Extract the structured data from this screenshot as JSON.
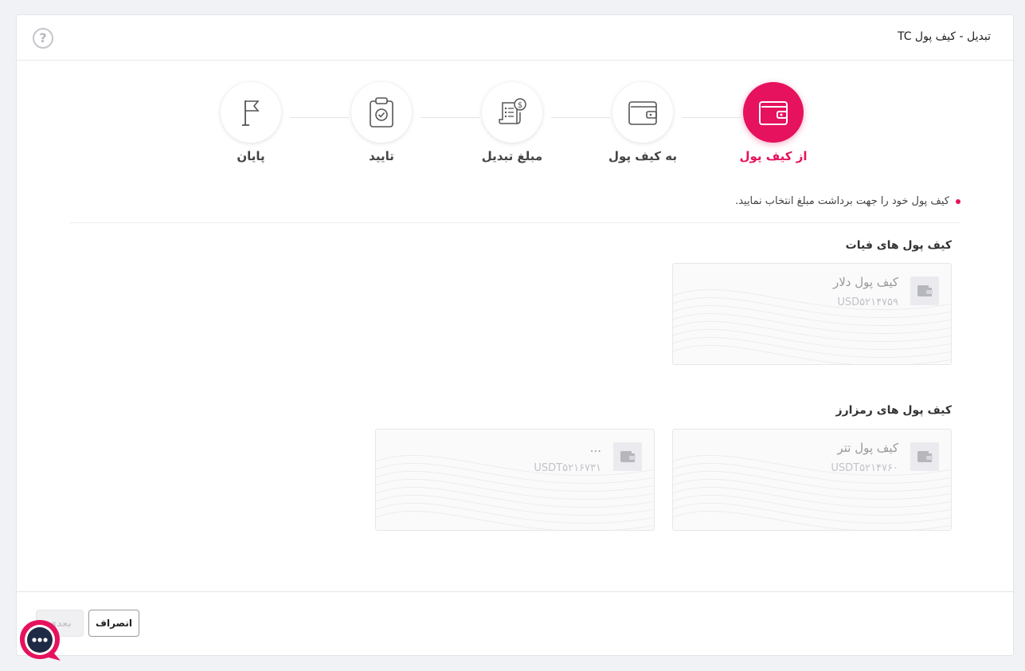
{
  "header": {
    "title": "تبدیل - کیف پول TC"
  },
  "steps": [
    {
      "label": "از کیف پول",
      "icon": "wallet-icon",
      "active": true
    },
    {
      "label": "به کیف پول",
      "icon": "wallet-icon",
      "active": false
    },
    {
      "label": "مبلغ تبدیل",
      "icon": "receipt-dollar-icon",
      "active": false
    },
    {
      "label": "تایید",
      "icon": "clipboard-check-icon",
      "active": false
    },
    {
      "label": "پایان",
      "icon": "flag-icon",
      "active": false
    }
  ],
  "instruction": "کیف پول خود را جهت برداشت مبلغ انتخاب نمایید.",
  "fiat": {
    "title": "کیف پول های فیات",
    "wallets": [
      {
        "name": "کیف پول دلار",
        "code": "USD۵۲۱۴۷۵۹"
      }
    ]
  },
  "crypto": {
    "title": "کیف پول های رمزارز",
    "wallets": [
      {
        "name": "کیف پول تتر",
        "code": "USDT۵۲۱۴۷۶۰"
      },
      {
        "name": "...",
        "code": "USDT۵۲۱۶۷۳۱"
      }
    ]
  },
  "footer": {
    "cancel_label": "انصراف",
    "next_label": "بعدی"
  },
  "colors": {
    "accent": "#e6125d",
    "background": "#f1f2f6"
  }
}
